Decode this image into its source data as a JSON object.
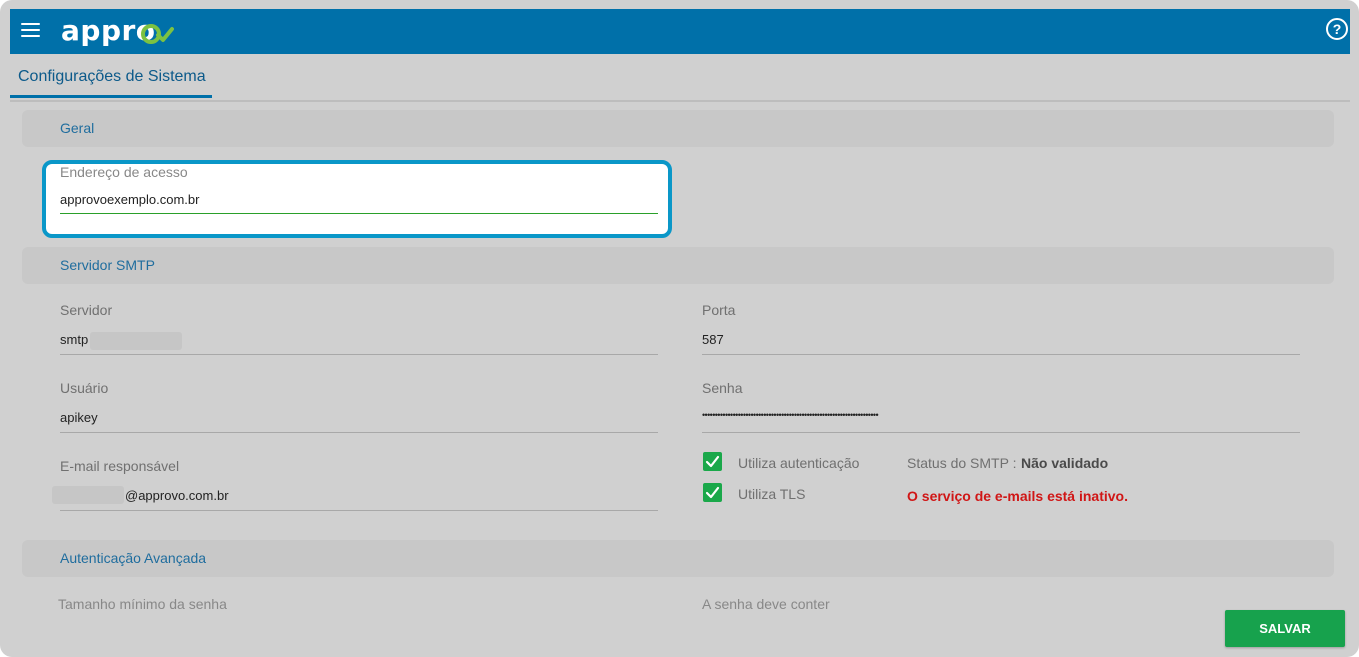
{
  "app": {
    "logo": "appro",
    "help_icon": "help-circle-icon",
    "menu_icon": "menu-icon"
  },
  "tabs": [
    {
      "label": "Configurações de Sistema"
    }
  ],
  "sections": {
    "general": {
      "title": "Geral",
      "access_address": {
        "label": "Endereço de acesso",
        "value": "approvoexemplo.com.br"
      }
    },
    "smtp": {
      "title": "Servidor SMTP",
      "server": {
        "label": "Servidor",
        "value": "smtp"
      },
      "port": {
        "label": "Porta",
        "value": "587"
      },
      "user": {
        "label": "Usuário",
        "value": "apikey"
      },
      "password": {
        "label": "Senha",
        "value": "•••••••••••••••••••••••••••••••••••••••••••••••••••••••••••••••••••••"
      },
      "responsible_email": {
        "label": "E-mail responsável",
        "value": "@approvo.com.br"
      },
      "use_auth": {
        "label": "Utiliza autenticação",
        "checked": true
      },
      "use_tls": {
        "label": "Utiliza TLS",
        "checked": true
      },
      "status_label": "Status do SMTP :",
      "status_value": "Não validado",
      "error_message": "O serviço de e-mails está inativo."
    },
    "advanced": {
      "title": "Autenticação Avançada",
      "min_password": {
        "label": "Tamanho mínimo da senha"
      },
      "password_must": {
        "label": "A senha deve conter"
      }
    }
  },
  "actions": {
    "save_label": "SALVAR"
  },
  "colors": {
    "brand": "#0070a9",
    "success": "#17a24d",
    "error": "#d01616",
    "highlight": "#0a97c8"
  }
}
